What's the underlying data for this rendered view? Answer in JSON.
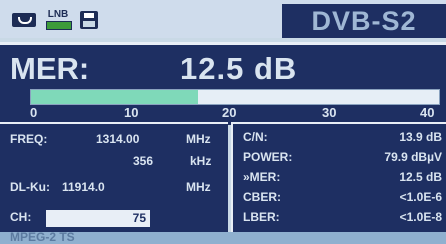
{
  "header": {
    "lnb_label": "LNB",
    "mode": "DVB-S2"
  },
  "mer": {
    "label": "MER:",
    "value": "12.5 dB",
    "bar_fraction": 0.41,
    "scale": [
      "0",
      "10",
      "20",
      "30",
      "40"
    ]
  },
  "tuning": {
    "freq_label": "FREQ:",
    "freq_value": "1314.00",
    "freq_unit": "MHz",
    "offset_value": "356",
    "offset_unit": "kHz",
    "dl_label": "DL-Ku:",
    "dl_value": "11914.0",
    "dl_unit": "MHz",
    "ch_label": "CH:",
    "ch_value": "75"
  },
  "measurements": [
    {
      "label": "C/N:",
      "value": "13.9 dB"
    },
    {
      "label": "POWER:",
      "value": "79.9 dBµV"
    },
    {
      "label": "»MER:",
      "value": "12.5 dB"
    },
    {
      "label": "CBER:",
      "value": "<1.0E-6"
    },
    {
      "label": "LBER:",
      "value": "<1.0E-8"
    }
  ],
  "footer": {
    "text": "MPEG-2 TS"
  },
  "colors": {
    "panel": "#1e2f62",
    "bar_fill": "#7fd9b9",
    "text": "#d9e4f0"
  },
  "icons": [
    "satellite-dish-icon",
    "lnb-power-icon",
    "save-disk-icon"
  ]
}
